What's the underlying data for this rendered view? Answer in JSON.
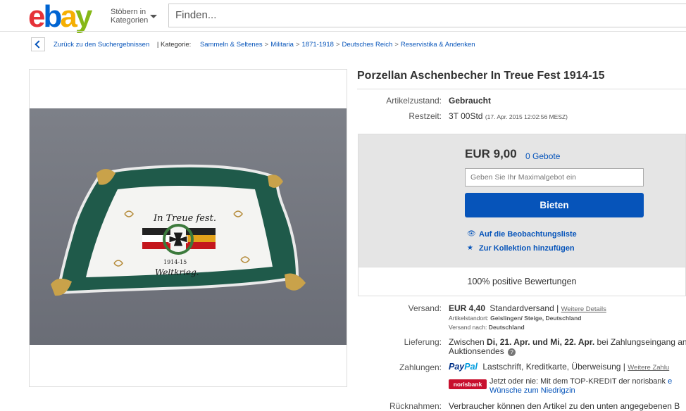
{
  "header": {
    "logo": {
      "e": "e",
      "b": "b",
      "a": "a",
      "y": "y"
    },
    "browse_line1": "Stöbern in",
    "browse_line2": "Kategorien",
    "search_placeholder": "Finden..."
  },
  "breadcrumb": {
    "back_label": "Zurück zu den Suchergebnissen",
    "category_label": "| Kategorie:",
    "items": [
      "Sammeln & Seltenes",
      "Militaria",
      "1871-1918",
      "Deutsches Reich",
      "Reservistika & Andenken"
    ]
  },
  "item": {
    "title": "Porzellan Aschenbecher In Treue Fest 1914-15",
    "condition_label": "Artikelzustand:",
    "condition_value": "Gebraucht",
    "time_label": "Restzeit:",
    "time_value": "3T 00Std",
    "time_detail": "(17. Apr. 2015  12:02:56 MESZ)"
  },
  "bid": {
    "price": "EUR 9,00",
    "bids": "0 Gebote",
    "max_placeholder": "Geben Sie Ihr Maximalgebot ein",
    "button": "Bieten",
    "watch": "Auf die Beobachtungsliste",
    "collection": "Zur Kollektion hinzufügen",
    "feedback": "100% positive Bewertungen"
  },
  "shipping": {
    "label": "Versand:",
    "price": "EUR 4,40",
    "method": "Standardversand |",
    "details_link": "Weitere Details",
    "location_label": "Artikelstandort:",
    "location_value": "Geislingen/ Steige, Deutschland",
    "shipto_label": "Versand nach:",
    "shipto_value": "Deutschland"
  },
  "delivery": {
    "label": "Lieferung:",
    "text_pre": "Zwischen ",
    "dates": "Di, 21. Apr. und Mi, 22. Apr.",
    "text_post": " bei Zahlungseingang an",
    "line2": "Auktionsendes"
  },
  "payments": {
    "label": "Zahlungen:",
    "paypal_1": "Pay",
    "paypal_2": "Pal",
    "methods": "Lastschrift,  Kreditkarte,  Überweisung  |",
    "more_link": "Weitere Zahlu",
    "norisbank_badge": "norisbank",
    "credit_text": "Jetzt oder nie: Mit dem TOP-KREDIT der norisbank",
    "credit_link1": "e",
    "credit_link2": "Wünsche zum Niedrigzin"
  },
  "returns": {
    "label": "Rücknahmen:",
    "text": "Verbraucher können den Artikel zu den unten angegebenen B"
  },
  "photo": {
    "plate_text_top": "In Treue fest.",
    "plate_text_year": "1914-15",
    "plate_text_bottom": "Weltkrieg."
  },
  "colors": {
    "accent": "#0654ba",
    "plate_green": "#1f5a4a",
    "gold": "#c9a24a"
  }
}
